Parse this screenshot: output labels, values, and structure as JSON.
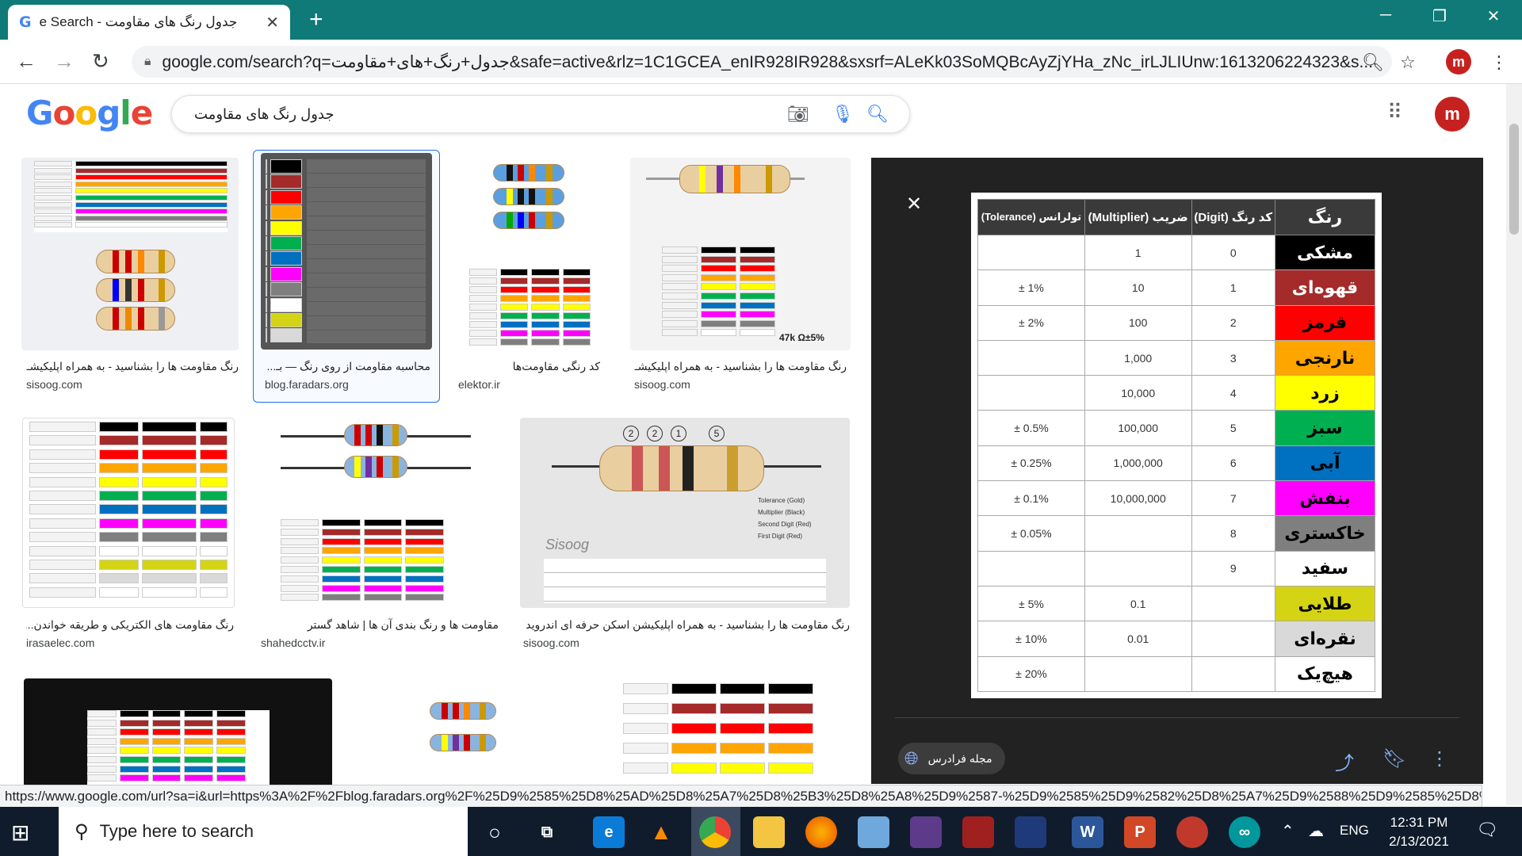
{
  "browser": {
    "tab_title": "e Search - جدول رنگ های مقاومت",
    "tab_favicon": "G",
    "new_tab_label": "+",
    "url_host": "google.com",
    "url_rest": "/search?q=جدول+رنگ+های+مقاومت&safe=active&rlz=1C1GCEA_enIR928IR928&sxsrf=ALeKk03SoMQBcAyZjYHa_zNc_irLJLIUnw:1613206224323&s...",
    "profile_initial": "m",
    "status_url": "https://www.google.com/url?sa=i&url=https%3A%2F%2Fblog.faradars.org%2F%25D9%2585%25D8%25AD%25D8%25A7%25D8%25B3%25D8%25A8%25D9%2587-%25D9%2585%25D9%2582%25D8%25A7%25D9%2588%25D9%2585%25D8%25AA-%25D8%25A7%25D8%25B2-%25D8%25B1%25D9%2588%25D9%258A-%25D8%25B1%25D9%2586%25DA%25AF..."
  },
  "google": {
    "logo": "Google",
    "query": "جدول رنگ های مقاومت",
    "profile_initial": "m"
  },
  "results": [
    {
      "caption": "رنگ مقاومت ها را بشناسید - به همراه اپلیکیشـ...",
      "source": "sisoog.com"
    },
    {
      "caption": "محاسبه مقاومت از روی رنگ — بـ...",
      "source": "blog.faradars.org"
    },
    {
      "caption": "کد رنگی مقاومت‌ها",
      "source": "elektor.ir"
    },
    {
      "caption": "رنگ مقاومت ها را بشناسید - به همراه اپلیکیشـ...",
      "source": "sisoog.com"
    },
    {
      "caption": "رنگ مقاومت های الکتریکی و طریقه خواندن...",
      "source": "irasaelec.com"
    },
    {
      "caption": "مقاومت ها و رنگ بندی آن ها | شاهد گستر",
      "source": "shahedcctv.ir"
    },
    {
      "caption": "رنگ مقاومت ها را بشناسید - به همراه اپلیکیشن اسکن حرفه ای اندروید",
      "source": "sisoog.com"
    }
  ],
  "thumb_texts": {
    "resistor_value": "47k Ω±5%",
    "watermark": "Sisoog",
    "band_labels": [
      "Tolerance (Gold)",
      "Multiplier (Black)",
      "Second Digit (Red)",
      "First Digit (Red)"
    ],
    "band_numbers": [
      "2",
      "2",
      "1",
      "5"
    ]
  },
  "preview": {
    "headers": [
      "رنگ",
      "کد رنگ (Digit)",
      "ضریب (Multiplier)",
      "تولرانس (Tolerance)"
    ],
    "rows": [
      {
        "name": "مشکی",
        "bg": "#000000",
        "fg": "#ffffff",
        "digit": "0",
        "multiplier": "1",
        "tolerance": ""
      },
      {
        "name": "قهوه‌ای",
        "bg": "#a52a2a",
        "fg": "#ffffff",
        "digit": "1",
        "multiplier": "10",
        "tolerance": "± 1%"
      },
      {
        "name": "قرمز",
        "bg": "#ff0000",
        "fg": "#000000",
        "digit": "2",
        "multiplier": "100",
        "tolerance": "± 2%"
      },
      {
        "name": "نارنجی",
        "bg": "#ffa500",
        "fg": "#000000",
        "digit": "3",
        "multiplier": "1,000",
        "tolerance": ""
      },
      {
        "name": "زرد",
        "bg": "#ffff00",
        "fg": "#000000",
        "digit": "4",
        "multiplier": "10,000",
        "tolerance": ""
      },
      {
        "name": "سبز",
        "bg": "#00b050",
        "fg": "#000000",
        "digit": "5",
        "multiplier": "100,000",
        "tolerance": "± 0.5%"
      },
      {
        "name": "آبی",
        "bg": "#0070c0",
        "fg": "#000000",
        "digit": "6",
        "multiplier": "1,000,000",
        "tolerance": "± 0.25%"
      },
      {
        "name": "بنفش",
        "bg": "#ff00ff",
        "fg": "#000000",
        "digit": "7",
        "multiplier": "10,000,000",
        "tolerance": "± 0.1%"
      },
      {
        "name": "خاکستری",
        "bg": "#7f7f7f",
        "fg": "#000000",
        "digit": "8",
        "multiplier": "",
        "tolerance": "± 0.05%"
      },
      {
        "name": "سفید",
        "bg": "#ffffff",
        "fg": "#000000",
        "digit": "9",
        "multiplier": "",
        "tolerance": ""
      },
      {
        "name": "طلایی",
        "bg": "#d4d414",
        "fg": "#000000",
        "digit": "",
        "multiplier": "0.1",
        "tolerance": "± 5%"
      },
      {
        "name": "نقره‌ای",
        "bg": "#d9d9d9",
        "fg": "#000000",
        "digit": "",
        "multiplier": "0.01",
        "tolerance": "± 10%"
      },
      {
        "name": "هیچ‌یک",
        "bg": "#ffffff",
        "fg": "#000000",
        "digit": "",
        "multiplier": "",
        "tolerance": "± 20%"
      }
    ],
    "source_chip": "مجله فرادرس"
  },
  "taskbar": {
    "search_placeholder": "Type here to search",
    "language": "ENG",
    "time": "12:31 PM",
    "date": "2/13/2021"
  },
  "icons": [
    "google-favicon",
    "close-icon",
    "plus-icon",
    "minimize-icon",
    "restore-icon",
    "back-arrow-icon",
    "forward-arrow-icon",
    "reload-icon",
    "lock-icon",
    "zoom-icon",
    "star-icon",
    "more-vert-icon",
    "camera-icon",
    "mic-icon",
    "search-icon",
    "apps-grid-icon",
    "globe-icon",
    "share-icon",
    "bookmark-icon",
    "windows-start-icon",
    "task-view-icon",
    "cortana-circle-icon"
  ]
}
